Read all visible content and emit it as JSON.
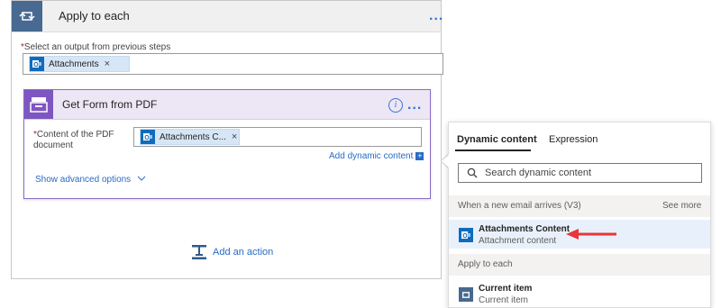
{
  "apply_each": {
    "title": "Apply to each",
    "select_label": "Select an output from previous steps",
    "token": "Attachments",
    "token_remove": "×"
  },
  "pdf_action": {
    "title": "Get Form from PDF",
    "field_label_line1": "Content of the PDF",
    "field_label_line2": "document",
    "token": "Attachments C...",
    "token_remove": "×",
    "add_dynamic": "Add dynamic content",
    "add_dynamic_plus": "+",
    "advanced": "Show advanced options",
    "info": "i"
  },
  "add_action": "Add an action",
  "dynamic_panel": {
    "tabs": [
      "Dynamic content",
      "Expression"
    ],
    "search_placeholder": "Search dynamic content",
    "section1": {
      "title": "When a new email arrives (V3)",
      "see_more": "See more",
      "items": [
        {
          "title": "Attachments Content",
          "subtitle": "Attachment content",
          "icon": "outlook-icon"
        }
      ]
    },
    "section2": {
      "title": "Apply to each",
      "items": [
        {
          "title": "Current item",
          "subtitle": "Current item",
          "icon": "loop-icon"
        }
      ]
    }
  },
  "colors": {
    "accent_blue": "#2a6bc4",
    "apply_header_icon": "#486991",
    "pdf_accent": "#7e56c2",
    "arrow_red": "#e8363a"
  },
  "ellipsis": "..."
}
